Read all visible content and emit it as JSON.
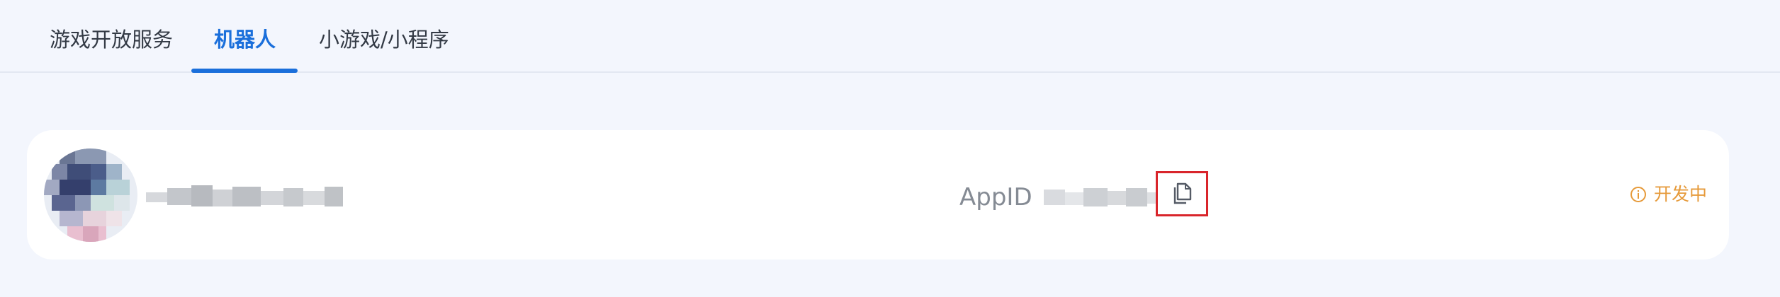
{
  "tabs": [
    {
      "label": "游戏开放服务",
      "active": false
    },
    {
      "label": "机器人",
      "active": true
    },
    {
      "label": "小游戏/小程序",
      "active": false
    }
  ],
  "bot_card": {
    "appid_label": "AppID",
    "status_label": "开发中",
    "status_color": "#e69a3a",
    "copy_icon": "copy-icon",
    "status_icon": "info-circle-icon"
  },
  "colors": {
    "accent": "#1a6fdb",
    "highlight_box": "#d9252b",
    "page_background": "#f3f6fd"
  }
}
